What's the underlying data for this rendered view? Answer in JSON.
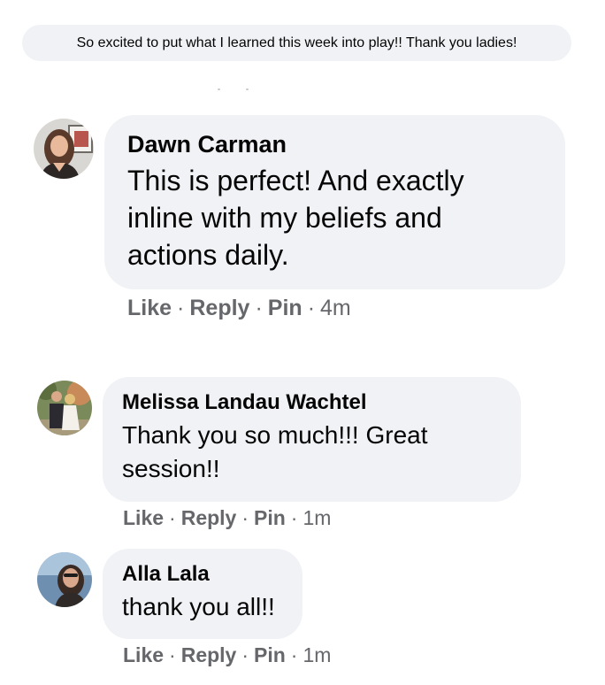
{
  "top_comment": {
    "text": "So excited to put what I learned this week into play!! Thank you ladies!"
  },
  "comments": [
    {
      "author": "Dawn Carman",
      "text": "This is perfect! And exactly inline with my beliefs and actions daily.",
      "text_lines": [
        "This is perfect! And exactly",
        "inline with my beliefs and",
        "actions daily."
      ],
      "like_label": "Like",
      "reply_label": "Reply",
      "pin_label": "Pin",
      "separator": "·",
      "time": "4m",
      "avatar_icon": "profile-photo-avatar"
    },
    {
      "author": "Melissa Landau Wachtel",
      "text": "Thank you so much!!! Great session!!",
      "text_lines": [
        "Thank you so much!!! Great",
        "session!!"
      ],
      "like_label": "Like",
      "reply_label": "Reply",
      "pin_label": "Pin",
      "separator": "·",
      "time": "1m",
      "avatar_icon": "profile-photo-avatar"
    },
    {
      "author": "Alla Lala",
      "text": "thank you all!!",
      "text_lines": [
        "thank you all!!"
      ],
      "like_label": "Like",
      "reply_label": "Reply",
      "pin_label": "Pin",
      "separator": "·",
      "time": "1m",
      "avatar_icon": "profile-photo-avatar"
    }
  ],
  "colors": {
    "bubble_background": "#f0f2f5",
    "primary_text": "#050505",
    "secondary_text": "#65676b",
    "page_background": "#ffffff"
  }
}
